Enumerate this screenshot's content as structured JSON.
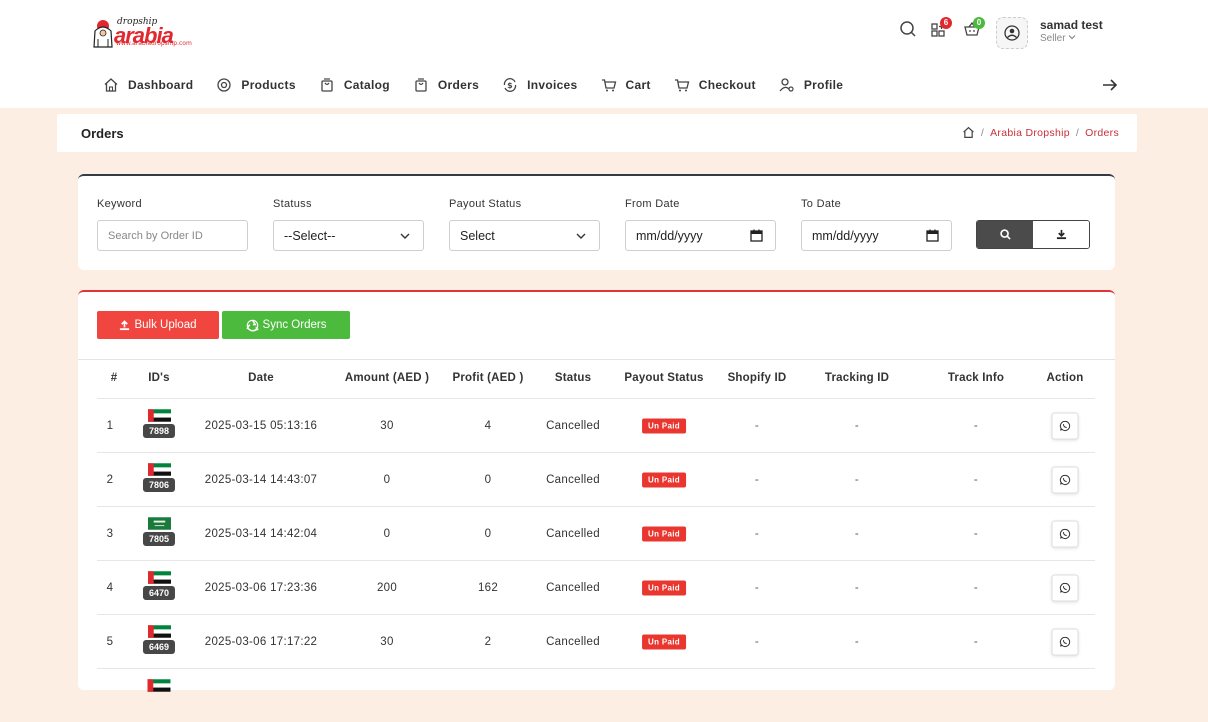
{
  "brand": {
    "tagline": "dropship",
    "name": "arabia",
    "url": "www.arabiadropship.com"
  },
  "header": {
    "apps_badge": "6",
    "cart_badge": "0",
    "user_name": "samad test",
    "user_role": "Seller",
    "badge_colors": {
      "apps": "#e0282f",
      "cart": "#4cbb3d"
    }
  },
  "nav": [
    {
      "label": "Dashboard",
      "icon": "home-icon"
    },
    {
      "label": "Products",
      "icon": "target-icon"
    },
    {
      "label": "Catalog",
      "icon": "bag-icon"
    },
    {
      "label": "Orders",
      "icon": "bag-icon"
    },
    {
      "label": "Invoices",
      "icon": "dollar-cycle-icon"
    },
    {
      "label": "Cart",
      "icon": "cart-icon"
    },
    {
      "label": "Checkout",
      "icon": "cart-icon"
    },
    {
      "label": "Profile",
      "icon": "user-gear-icon"
    }
  ],
  "page": {
    "title": "Orders",
    "breadcrumb": [
      "Arabia Dropship",
      "Orders"
    ]
  },
  "filters": {
    "keyword_label": "Keyword",
    "keyword_placeholder": "Search by Order ID",
    "status_label": "Statuss",
    "status_value": "--Select--",
    "payout_label": "Payout Status",
    "payout_value": "Select",
    "from_label": "From Date",
    "from_value": "mm/dd/yyyy",
    "to_label": "To Date",
    "to_value": "mm/dd/yyyy"
  },
  "actions": {
    "bulk_upload": "Bulk Upload",
    "sync_orders": "Sync Orders"
  },
  "table": {
    "headers": [
      "#",
      "ID's",
      "Date",
      "Amount (AED )",
      "Profit (AED )",
      "Status",
      "Payout Status",
      "Shopify ID",
      "Tracking ID",
      "Track Info",
      "Action"
    ],
    "rows": [
      {
        "num": "1",
        "flag": "uae",
        "id": "7898",
        "date": "2025-03-15 05:13:16",
        "amount": "30",
        "profit": "4",
        "status": "Cancelled",
        "payout": "Un Paid",
        "shopify": "-",
        "tracking": "-",
        "track_info": "-"
      },
      {
        "num": "2",
        "flag": "uae",
        "id": "7806",
        "date": "2025-03-14 14:43:07",
        "amount": "0",
        "profit": "0",
        "status": "Cancelled",
        "payout": "Un Paid",
        "shopify": "-",
        "tracking": "-",
        "track_info": "-"
      },
      {
        "num": "3",
        "flag": "ksa",
        "id": "7805",
        "date": "2025-03-14 14:42:04",
        "amount": "0",
        "profit": "0",
        "status": "Cancelled",
        "payout": "Un Paid",
        "shopify": "-",
        "tracking": "-",
        "track_info": "-"
      },
      {
        "num": "4",
        "flag": "uae",
        "id": "6470",
        "date": "2025-03-06 17:23:36",
        "amount": "200",
        "profit": "162",
        "status": "Cancelled",
        "payout": "Un Paid",
        "shopify": "-",
        "tracking": "-",
        "track_info": "-"
      },
      {
        "num": "5",
        "flag": "uae",
        "id": "6469",
        "date": "2025-03-06 17:17:22",
        "amount": "30",
        "profit": "2",
        "status": "Cancelled",
        "payout": "Un Paid",
        "shopify": "-",
        "tracking": "-",
        "track_info": "-"
      }
    ]
  },
  "colors": {
    "accent_red": "#e2333b",
    "accent_green": "#4cbb3d",
    "page_bg": "#fdeee4",
    "dark": "#343a46"
  }
}
